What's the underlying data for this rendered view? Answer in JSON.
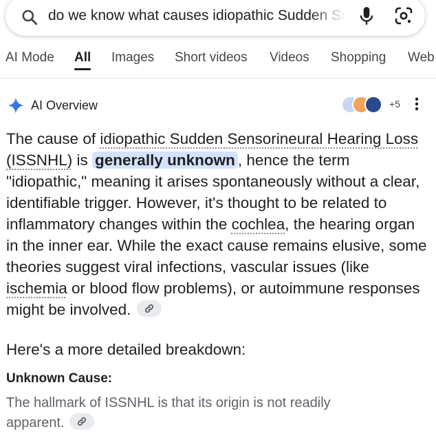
{
  "search": {
    "query": "do we know what causes idiopathic Sudden Sensorineural Hearing Loss"
  },
  "tabs": [
    "AI Mode",
    "All",
    "Images",
    "Short videos",
    "Videos",
    "Shopping",
    "Web"
  ],
  "active_tab": "All",
  "ai_overview": {
    "title": "AI Overview",
    "sources_more": "+5",
    "paragraph": [
      {
        "text": "The cause of "
      },
      {
        "text": "idiopathic Sudden Sensorineural Hearing Loss (ISSNHL)",
        "style": "link"
      },
      {
        "text": " is "
      },
      {
        "text": "generally unknown",
        "style": "highlight"
      },
      {
        "text": ", hence the term \"idiopathic,\" meaning it arises spontaneously without a clear, identifiable trigger. However, it's thought to be related to inflammatory changes within the "
      },
      {
        "text": "cochlea",
        "style": "link"
      },
      {
        "text": ", the hearing organ in the inner ear. While the exact cause remains elusive, some theories suggest viral infections, vascular issues (like "
      },
      {
        "text": "ischemia",
        "style": "link"
      },
      {
        "text": " or blood flow problems), or autoimmune responses might be involved."
      }
    ],
    "breakdown_heading": "Here's a more detailed breakdown:",
    "subheading": "Unknown Cause:",
    "subtext": "The hallmark of ISSNHL is that its origin is not readily apparent."
  },
  "colors": {
    "highlight_bg": "#d3e3fd",
    "chip_bg": "#e8eaed",
    "text_primary": "#1f1f1f",
    "text_secondary": "#5f6368"
  },
  "icons": [
    "search-icon",
    "microphone-icon",
    "google-lens-icon",
    "ai-sparkle-icon",
    "source-avatar-icon",
    "more-vert-icon",
    "link-icon"
  ]
}
